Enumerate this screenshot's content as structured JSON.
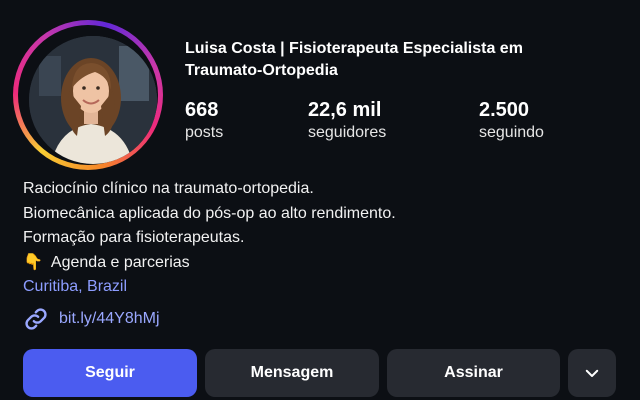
{
  "profile": {
    "name_line1": "Luisa Costa | Fisioterapeuta Especialista em",
    "name_line2": "Traumato-Ortopedia"
  },
  "stats": {
    "posts": {
      "value": "668",
      "label": "posts"
    },
    "followers": {
      "value": "22,6 mil",
      "label": "seguidores"
    },
    "following": {
      "value": "2.500",
      "label": "seguindo"
    }
  },
  "bio": {
    "line1": "Raciocínio clínico na traumato-ortopedia.",
    "line2": "Biomecânica aplicada do pós-op ao alto rendimento.",
    "line3": "Formação para fisioterapeutas.",
    "line4_icon": "👇",
    "line4_text": "Agenda e parcerias",
    "location": "Curitiba, Brazil"
  },
  "link": {
    "icon": "link-icon",
    "text": "bit.ly/44Y8hMj"
  },
  "actions": {
    "follow": "Seguir",
    "message": "Mensagem",
    "subscribe": "Assinar",
    "more_icon": "chevron-down-icon"
  },
  "colors": {
    "background": "#0c0f14",
    "primary_button": "#4b5cf0",
    "secondary_button": "#272a31",
    "link": "#9aa8ff"
  }
}
